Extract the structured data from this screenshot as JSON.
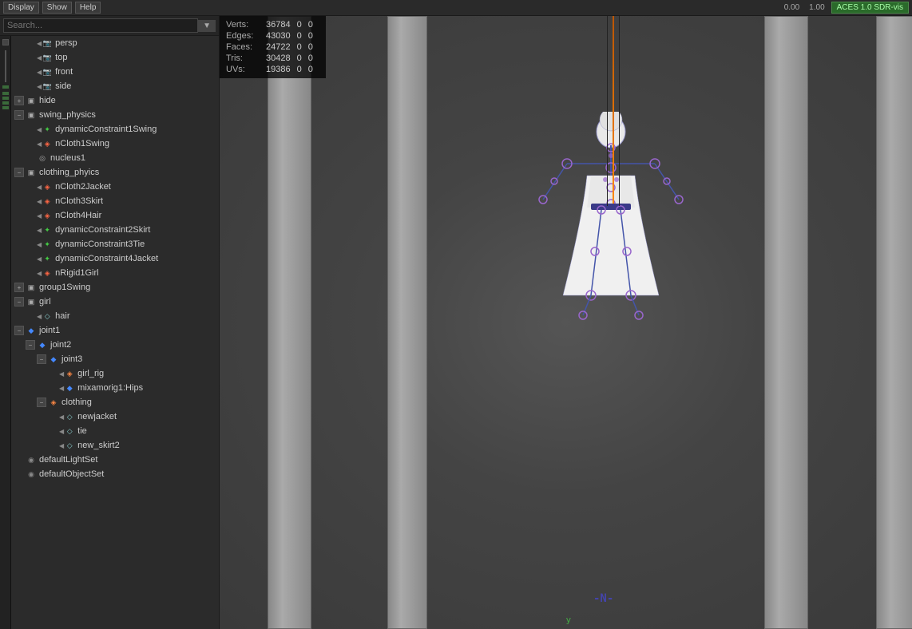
{
  "toolbar": {
    "buttons": [
      "Display",
      "Show",
      "Help"
    ],
    "time_display": "0.00",
    "time_end": "1.00",
    "renderer": "ACES 1.0 SDR-vis"
  },
  "search": {
    "placeholder": "Search...",
    "value": ""
  },
  "outliner": {
    "items": [
      {
        "id": "persp",
        "label": "persp",
        "indent": 1,
        "icon": "camera",
        "expandable": false,
        "arrow": true
      },
      {
        "id": "top",
        "label": "top",
        "indent": 1,
        "icon": "camera",
        "expandable": false,
        "arrow": true
      },
      {
        "id": "front",
        "label": "front",
        "indent": 1,
        "icon": "camera",
        "expandable": false,
        "arrow": true
      },
      {
        "id": "side",
        "label": "side",
        "indent": 1,
        "icon": "camera",
        "expandable": false,
        "arrow": true
      },
      {
        "id": "hide",
        "label": "hide",
        "indent": 0,
        "icon": "group",
        "expandable": true,
        "expanded": false
      },
      {
        "id": "swing_physics",
        "label": "swing_physics",
        "indent": 0,
        "icon": "group",
        "expandable": true,
        "expanded": true
      },
      {
        "id": "dynamicConstraint1Swing",
        "label": "dynamicConstraint1Swing",
        "indent": 1,
        "icon": "dynamic",
        "expandable": false,
        "arrow": true
      },
      {
        "id": "nCloth1Swing",
        "label": "nCloth1Swing",
        "indent": 1,
        "icon": "ncloth",
        "expandable": false,
        "arrow": true
      },
      {
        "id": "nucleus1",
        "label": "nucleus1",
        "indent": 1,
        "icon": "nucleus",
        "expandable": false
      },
      {
        "id": "clothing_phyics",
        "label": "clothing_phyics",
        "indent": 0,
        "icon": "group",
        "expandable": true,
        "expanded": true
      },
      {
        "id": "nCloth2Jacket",
        "label": "nCloth2Jacket",
        "indent": 1,
        "icon": "ncloth",
        "expandable": false,
        "arrow": true
      },
      {
        "id": "nCloth3Skirt",
        "label": "nCloth3Skirt",
        "indent": 1,
        "icon": "ncloth",
        "expandable": false,
        "arrow": true
      },
      {
        "id": "nCloth4Hair",
        "label": "nCloth4Hair",
        "indent": 1,
        "icon": "ncloth",
        "expandable": false,
        "arrow": true
      },
      {
        "id": "dynamicConstraint2Skirt",
        "label": "dynamicConstraint2Skirt",
        "indent": 1,
        "icon": "dynamic",
        "expandable": false,
        "arrow": true
      },
      {
        "id": "dynamicConstraint3Tie",
        "label": "dynamicConstraint3Tie",
        "indent": 1,
        "icon": "dynamic",
        "expandable": false,
        "arrow": true
      },
      {
        "id": "dynamicConstraint4Jacket",
        "label": "dynamicConstraint4Jacket",
        "indent": 1,
        "icon": "dynamic",
        "expandable": false,
        "arrow": true
      },
      {
        "id": "nRigid1Girl",
        "label": "nRigid1Girl",
        "indent": 1,
        "icon": "rigid",
        "expandable": false,
        "arrow": true
      },
      {
        "id": "group1Swing",
        "label": "group1Swing",
        "indent": 0,
        "icon": "group",
        "expandable": true,
        "expanded": false
      },
      {
        "id": "girl",
        "label": "girl",
        "indent": 0,
        "icon": "group",
        "expandable": true,
        "expanded": true
      },
      {
        "id": "hair",
        "label": "hair",
        "indent": 1,
        "icon": "hair",
        "expandable": false,
        "arrow": true
      },
      {
        "id": "joint1",
        "label": "joint1",
        "indent": 0,
        "icon": "joint",
        "expandable": true,
        "expanded": true
      },
      {
        "id": "joint2",
        "label": "joint2",
        "indent": 1,
        "icon": "joint",
        "expandable": true,
        "expanded": true
      },
      {
        "id": "joint3",
        "label": "joint3",
        "indent": 2,
        "icon": "joint",
        "expandable": true,
        "expanded": true
      },
      {
        "id": "girl_rig",
        "label": "girl_rig",
        "indent": 3,
        "icon": "mesh",
        "expandable": false,
        "arrow": true
      },
      {
        "id": "mixamorig1Hips",
        "label": "mixamorig1:Hips",
        "indent": 3,
        "icon": "joint",
        "expandable": false,
        "arrow": true
      },
      {
        "id": "clothing",
        "label": "clothing",
        "indent": 2,
        "icon": "clothing",
        "expandable": true,
        "expanded": true
      },
      {
        "id": "newjacket",
        "label": "newjacket",
        "indent": 3,
        "icon": "hair",
        "expandable": false,
        "arrow": true
      },
      {
        "id": "tie",
        "label": "tie",
        "indent": 3,
        "icon": "hair",
        "expandable": false,
        "arrow": true
      },
      {
        "id": "new_skirt2",
        "label": "new_skirt2",
        "indent": 3,
        "icon": "hair",
        "expandable": false,
        "arrow": true
      },
      {
        "id": "defaultLightSet",
        "label": "defaultLightSet",
        "indent": 0,
        "icon": "set",
        "expandable": false
      },
      {
        "id": "defaultObjectSet",
        "label": "defaultObjectSet",
        "indent": 0,
        "icon": "set",
        "expandable": false
      }
    ]
  },
  "stats": {
    "rows": [
      {
        "label": "Verts:",
        "val1": "36784",
        "val2": "0",
        "val3": "0"
      },
      {
        "label": "Edges:",
        "val1": "43030",
        "val2": "0",
        "val3": "0"
      },
      {
        "label": "Faces:",
        "val1": "24722",
        "val2": "0",
        "val3": "0"
      },
      {
        "label": "Tris:",
        "val1": "30428",
        "val2": "0",
        "val3": "0"
      },
      {
        "label": "UVs:",
        "val1": "19386",
        "val2": "0",
        "val3": "0"
      }
    ]
  },
  "viewport": {
    "coord_label": "y",
    "n_label": "-N-"
  },
  "icons": {
    "camera": "📷",
    "group": "▣",
    "ncloth": "◈",
    "nucleus": "◎",
    "dynamic": "✦",
    "rigid": "◈",
    "joint": "◆",
    "mesh": "◈",
    "hair": "◇",
    "clothing": "◈",
    "set": "◉",
    "transform": "▣"
  }
}
